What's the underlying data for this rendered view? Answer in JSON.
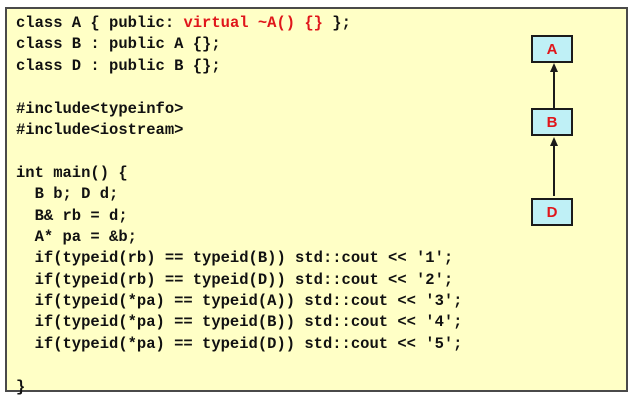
{
  "code": {
    "lines": [
      {
        "pre": "class A { public: ",
        "red": "virtual ~A() {}",
        "post": " };"
      },
      {
        "text": "class B : public A {};"
      },
      {
        "text": "class D : public B {};"
      },
      {
        "text": ""
      },
      {
        "text": "#include<typeinfo>"
      },
      {
        "text": "#include<iostream>"
      },
      {
        "text": ""
      },
      {
        "text": "int main() {"
      },
      {
        "text": "  B b; D d;"
      },
      {
        "text": "  B& rb = d;"
      },
      {
        "text": "  A* pa = &b;"
      },
      {
        "text": "  if(typeid(rb) == typeid(B)) std::cout << '1';"
      },
      {
        "text": "  if(typeid(rb) == typeid(D)) std::cout << '2';"
      },
      {
        "text": "  if(typeid(*pa) == typeid(A)) std::cout << '3';"
      },
      {
        "text": "  if(typeid(*pa) == typeid(B)) std::cout << '4';"
      },
      {
        "text": "  if(typeid(*pa) == typeid(D)) std::cout << '5';"
      },
      {
        "text": ""
      },
      {
        "text": "}"
      }
    ]
  },
  "diagram": {
    "nodes": [
      "A",
      "B",
      "D"
    ],
    "edges": [
      {
        "from": "D",
        "to": "B"
      },
      {
        "from": "B",
        "to": "A"
      }
    ]
  },
  "colors": {
    "background": "#ffffc6",
    "node_fill": "#bff0f6",
    "highlight": "#e0161b",
    "border": "#4a4a4a"
  }
}
